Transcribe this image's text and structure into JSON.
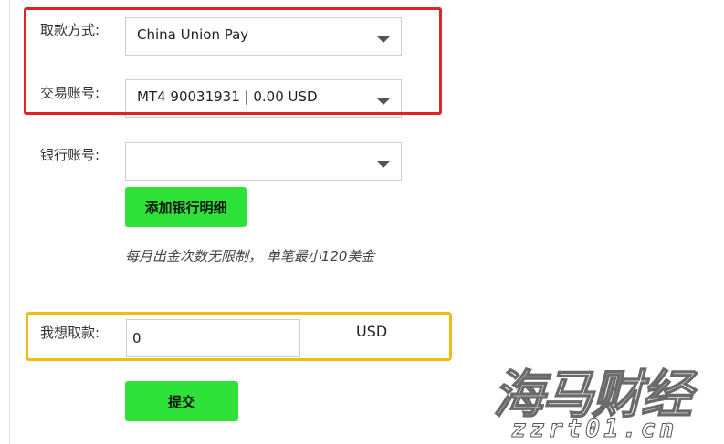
{
  "form": {
    "method_label": "取款方式:",
    "method_value": "China Union Pay",
    "account_label": "交易账号:",
    "account_value": "MT4 90031931 | 0.00 USD",
    "bank_label": "银行账号:",
    "bank_value": "",
    "add_bank_button": "添加银行明细",
    "note": "每月出金次数无限制， 单笔最小120美金",
    "amount_label": "我想取款:",
    "amount_value": "0",
    "currency": "USD",
    "submit_button": "提交"
  },
  "watermark": {
    "logo_text": "海马财经",
    "url_text": "zzrt01.cn"
  },
  "colors": {
    "highlight_red": "#e02424",
    "highlight_yellow": "#f1bb14",
    "button_green": "#2fe23a"
  }
}
